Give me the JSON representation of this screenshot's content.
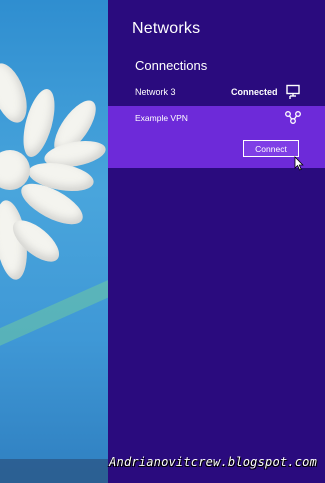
{
  "panel": {
    "title": "Networks",
    "section_header": "Connections",
    "networks": [
      {
        "name": "Network  3",
        "status": "Connected",
        "icon": "wired-network-icon"
      }
    ],
    "vpn": {
      "name": "Example VPN",
      "icon": "vpn-icon",
      "connect_label": "Connect"
    }
  },
  "watermark": "Andrianovitcrew.blogspot.com",
  "colors": {
    "panel_background": "#2a0b7e",
    "selected_item": "#6d2ad9",
    "desktop_sky": "#3f98d6"
  }
}
